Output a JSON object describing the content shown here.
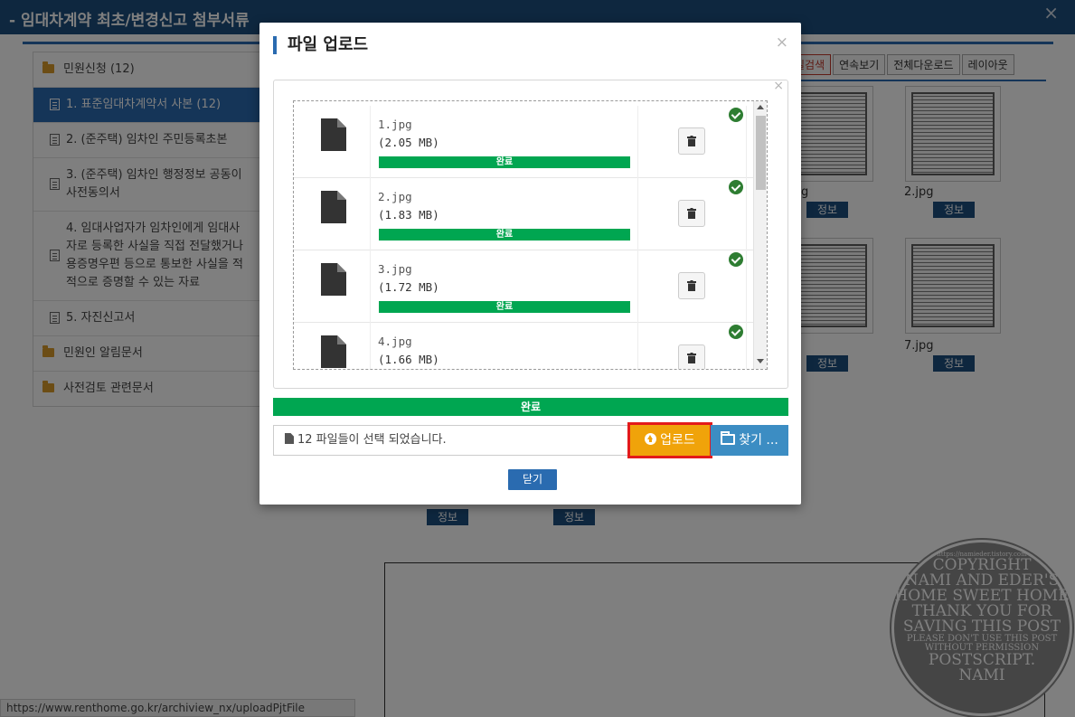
{
  "window": {
    "title": "- 임대차계약 최초/변경신고 첨부서류",
    "close": "×"
  },
  "tree": {
    "items": [
      {
        "type": "folder",
        "label": "민원신청 (12)"
      },
      {
        "type": "doc",
        "label": "1. 표준임대차계약서 사본 (12)",
        "active": true
      },
      {
        "type": "doc",
        "label": "2. (준주택) 임차인 주민등록초본"
      },
      {
        "type": "doc",
        "lines": [
          "3. (준주택) 임차인 행정정보 공동이",
          "사전동의서"
        ]
      },
      {
        "type": "doc",
        "lines": [
          "4. 임대사업자가 임차인에게 임대사",
          "자로 등록한 사실을 직접 전달했거나",
          "용증명우편 등으로 통보한 사실을 적",
          "적으로 증명할 수 있는 자료"
        ]
      },
      {
        "type": "doc",
        "label": "5. 자진신고서"
      },
      {
        "type": "folder",
        "label": "민원인 알림문서"
      },
      {
        "type": "folder",
        "label": "사전검토 관련문서"
      }
    ]
  },
  "toolbar": {
    "buttons": [
      "일검색",
      "연속보기",
      "전체다운로드",
      "레이아웃"
    ]
  },
  "thumbnails": [
    {
      "name": "g",
      "info": "정보"
    },
    {
      "name": "2.jpg",
      "info": "정보"
    },
    {
      "name": "",
      "info": "정보"
    },
    {
      "name": "7.jpg",
      "info": "정보"
    },
    {
      "name": "",
      "info": "정보"
    },
    {
      "name": "",
      "info": "정보"
    }
  ],
  "statusbar": {
    "url": "https://www.renthome.go.kr/archiview_nx/uploadPjtFile"
  },
  "watermark": {
    "lines": [
      "https://namieder.tistory.com",
      "COPYRIGHT",
      "NAMI AND EDER'S",
      "HOME SWEET HOME",
      "THANK YOU FOR",
      "SAVING THIS POST",
      "PLEASE DON'T USE THIS POST",
      "WITHOUT PERMISSION",
      "POSTSCRIPT.",
      "NAMI"
    ]
  },
  "modal": {
    "title": "파일 업로드",
    "close": "×",
    "panel_close": "×",
    "files": [
      {
        "name": "1.jpg",
        "size": "(2.05 MB)",
        "status": "완료",
        "progress": 1.0
      },
      {
        "name": "2.jpg",
        "size": "(1.83 MB)",
        "status": "완료",
        "progress": 1.0
      },
      {
        "name": "3.jpg",
        "size": "(1.72 MB)",
        "status": "완료",
        "progress": 1.0
      },
      {
        "name": "4.jpg",
        "size": "(1.66 MB)",
        "status": "완료",
        "progress": 1.0
      }
    ],
    "total_status": "완료",
    "file_input_text": "12 파일들이 선택 되었습니다.",
    "upload_label": "업로드",
    "browse_label": "찾기 ...",
    "close_label": "닫기"
  },
  "colors": {
    "titlebar": "#1d4f7e",
    "accent_blue": "#2a6bb0",
    "progress_green": "#00a651",
    "upload_orange": "#f0a30a",
    "highlight_red": "#e31a1a",
    "browse_blue": "#3c8dc3"
  }
}
